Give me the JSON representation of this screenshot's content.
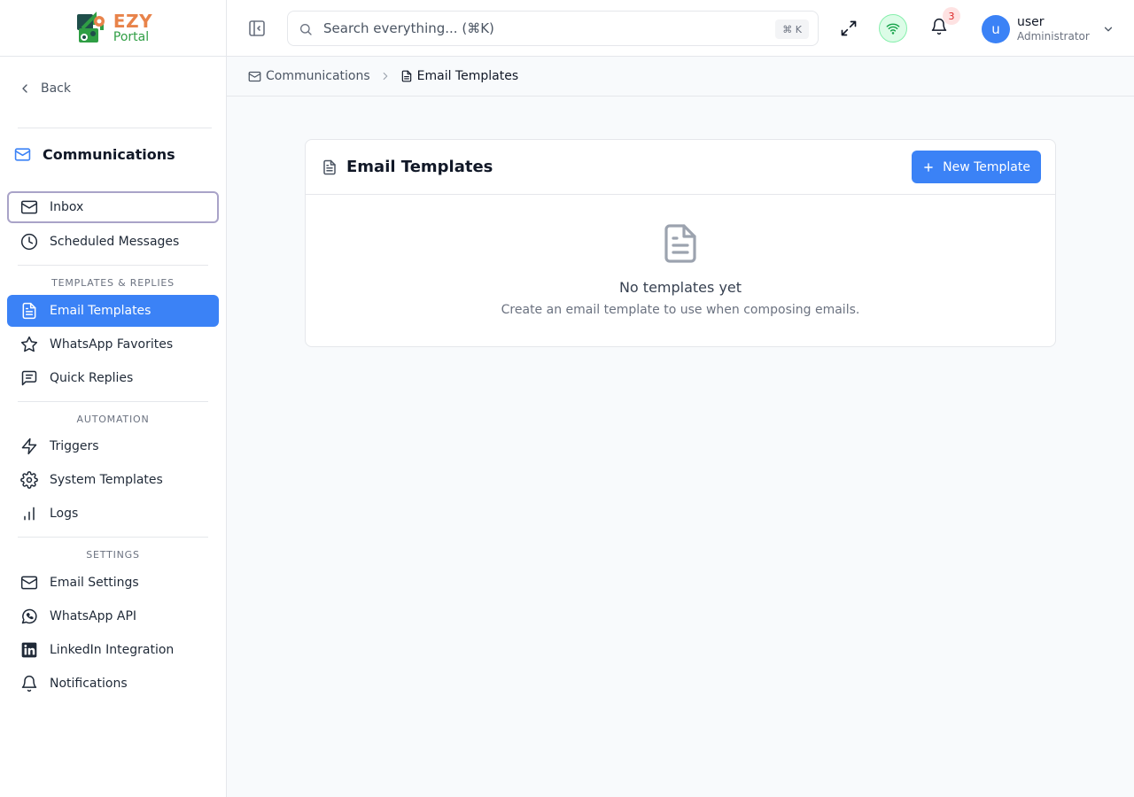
{
  "brand": {
    "line1": "EZY",
    "line2": "Portal"
  },
  "sidebar": {
    "back_label": "Back",
    "section_title": "Communications",
    "items": [
      {
        "label": "Inbox",
        "icon": "mail-icon"
      },
      {
        "label": "Scheduled Messages",
        "icon": "clock-icon"
      }
    ],
    "groups": [
      {
        "label": "TEMPLATES & REPLIES",
        "items": [
          {
            "label": "Email Templates",
            "icon": "file-text-icon",
            "active": true
          },
          {
            "label": "WhatsApp Favorites",
            "icon": "star-icon"
          },
          {
            "label": "Quick Replies",
            "icon": "message-square-icon"
          }
        ]
      },
      {
        "label": "AUTOMATION",
        "items": [
          {
            "label": "Triggers",
            "icon": "zap-icon"
          },
          {
            "label": "System Templates",
            "icon": "gear-icon"
          },
          {
            "label": "Logs",
            "icon": "bar-chart-icon"
          }
        ]
      },
      {
        "label": "SETTINGS",
        "items": [
          {
            "label": "Email Settings",
            "icon": "mail-icon"
          },
          {
            "label": "WhatsApp API",
            "icon": "whatsapp-icon"
          },
          {
            "label": "LinkedIn Integration",
            "icon": "linkedin-icon"
          },
          {
            "label": "Notifications",
            "icon": "bell-icon"
          }
        ]
      }
    ]
  },
  "header": {
    "search": {
      "placeholder": "Search everything... (⌘K)",
      "value": "",
      "shortcut": "⌘ K"
    },
    "notifications_count": "3",
    "user": {
      "initial": "u",
      "name": "user",
      "role": "Administrator"
    }
  },
  "breadcrumb": {
    "parent": "Communications",
    "current": "Email Templates"
  },
  "main": {
    "card_title": "Email Templates",
    "new_button_label": "New Template",
    "empty_title": "No templates yet",
    "empty_description": "Create an email template to use when composing emails."
  },
  "colors": {
    "primary": "#3b82f6",
    "brand_orange": "#e8834a",
    "brand_green": "#2f9e44",
    "badge_red": "#dc2626"
  }
}
